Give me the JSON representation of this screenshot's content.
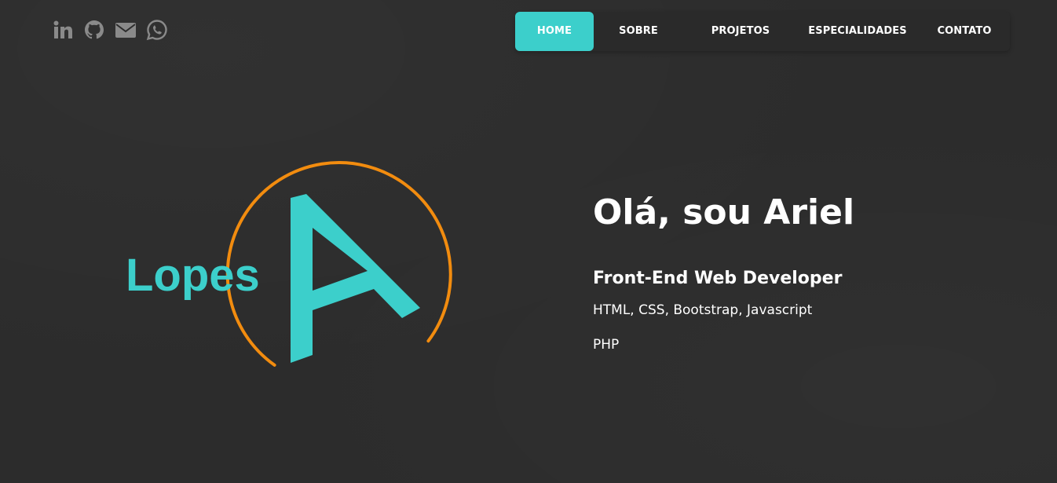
{
  "social": {
    "icons": [
      "linkedin-icon",
      "github-icon",
      "email-icon",
      "whatsapp-icon"
    ],
    "icon_color": "#8a8a8a"
  },
  "nav": {
    "items": [
      {
        "label": "HOME",
        "active": true
      },
      {
        "label": "SOBRE",
        "active": false
      },
      {
        "label": "PROJETOS",
        "active": false
      },
      {
        "label": "ESPECIALIDADES",
        "active": false
      },
      {
        "label": "CONTATO",
        "active": false
      }
    ],
    "accent_color": "#3ccfcb"
  },
  "logo": {
    "text": "Lopes",
    "letter": "A",
    "text_color": "#3ccfcb",
    "ring_color": "#f28c0f"
  },
  "hero": {
    "greeting": "Olá, sou Ariel",
    "role": "Front-End Web Developer",
    "skills": "HTML, CSS, Bootstrap, Javascript",
    "skills_extra": "PHP"
  },
  "colors": {
    "background": "#2c2c2c",
    "text": "#ffffff"
  }
}
